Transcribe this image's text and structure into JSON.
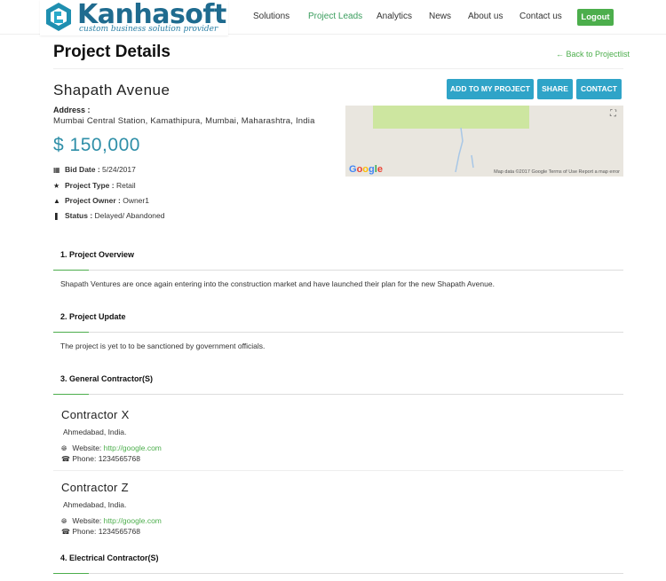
{
  "brand": {
    "name": "Kanhasoft",
    "tagline": "custom business solution provider"
  },
  "nav": {
    "items": [
      "Solutions",
      "Project Leads",
      "Analytics",
      "News",
      "About us",
      "Contact us"
    ],
    "logout": "Logout"
  },
  "page": {
    "title": "Project Details",
    "back_link": "Back to Projectlist"
  },
  "project": {
    "name": "Shapath Avenue",
    "address_label": "Address :",
    "address": "Mumbai Central Station, Kamathipura, Mumbai, Maharashtra, India",
    "price": "$ 150,000",
    "meta": [
      {
        "icon": "calendar-icon",
        "label": "Bid Date :",
        "value": "5/24/2017"
      },
      {
        "icon": "star-icon",
        "label": "Project Type :",
        "value": "Retail"
      },
      {
        "icon": "user-icon",
        "label": "Project Owner :",
        "value": "Owner1"
      },
      {
        "icon": "pause-icon",
        "label": "Status :",
        "value": "Delayed/ Abandoned"
      }
    ]
  },
  "actions": {
    "add": "ADD TO MY PROJECT",
    "share": "SHARE",
    "contact": "CONTACT"
  },
  "map": {
    "logo": "Google",
    "attribution": "Map data ©2017 Google   Terms of Use   Report a map error"
  },
  "sections": {
    "overview": {
      "title": "1. Project Overview",
      "text": "Shapath Ventures are once again entering into the construction market and have launched their plan for the new Shapath Avenue."
    },
    "update": {
      "title": "2. Project Update",
      "text": "The project is yet to to be sanctioned by government officials."
    },
    "general": {
      "title": "3. General Contractor(S)"
    },
    "electrical": {
      "title": "4. Electrical Contractor(S)"
    }
  },
  "contractors": [
    {
      "name": "Contractor X",
      "location": "Ahmedabad, India.",
      "website_label": "Website:",
      "website": "http://google.com",
      "phone_label": "Phone:",
      "phone": "1234565768"
    },
    {
      "name": "Contractor Z",
      "location": "Ahmedabad, India.",
      "website_label": "Website:",
      "website": "http://google.com",
      "phone_label": "Phone:",
      "phone": "1234565768"
    }
  ],
  "colors": {
    "accent_green": "#4cae4c",
    "button_blue": "#2fa4c8",
    "price_teal": "#2f8fa8",
    "brand_blue": "#1f6b8f"
  }
}
